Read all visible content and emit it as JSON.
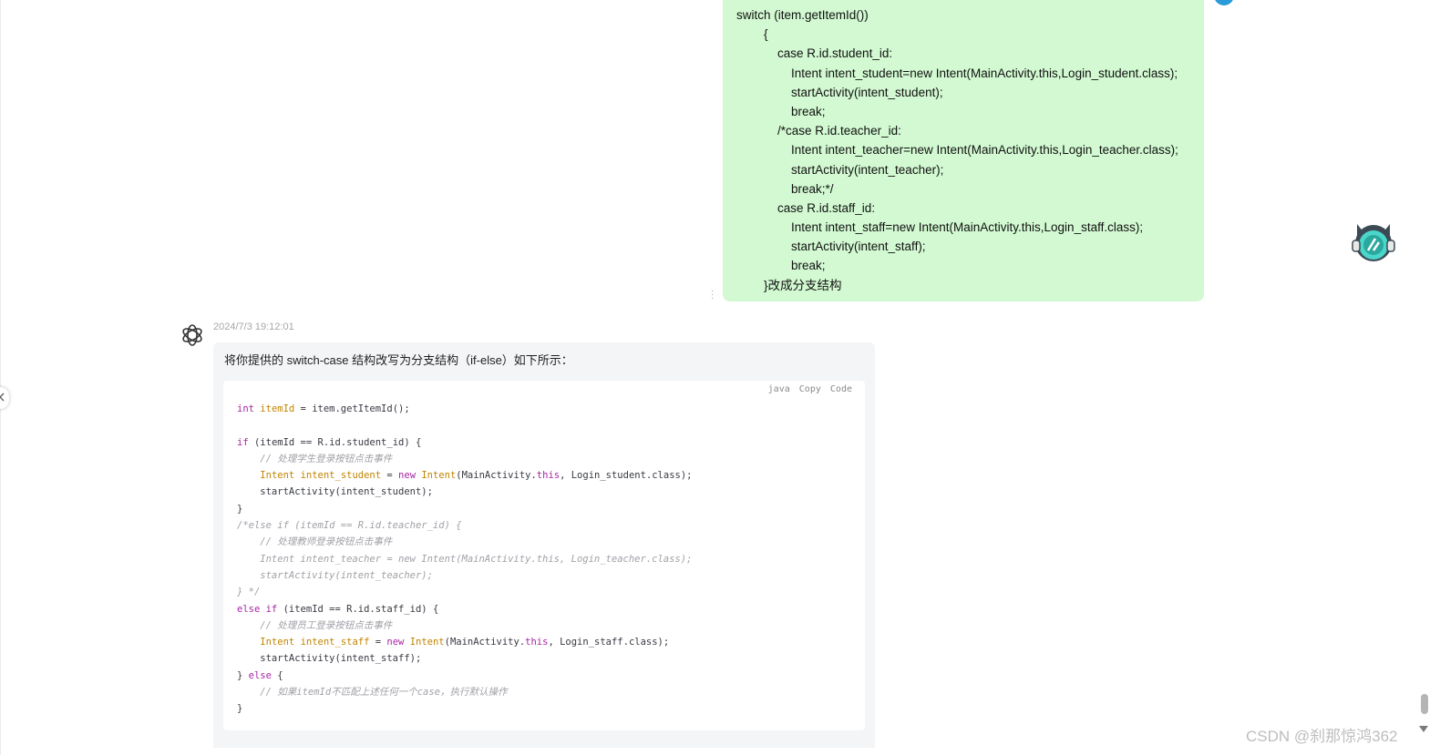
{
  "user_message": {
    "lines": [
      "switch (item.getItemId())",
      "        {",
      "            case R.id.student_id:",
      "                Intent intent_student=new Intent(MainActivity.this,Login_student.class);",
      "                startActivity(intent_student);",
      "                break;",
      "            /*case R.id.teacher_id:",
      "                Intent intent_teacher=new Intent(MainActivity.this,Login_teacher.class);",
      "                startActivity(intent_teacher);",
      "                break;*/",
      "            case R.id.staff_id:",
      "                Intent intent_staff=new Intent(MainActivity.this,Login_staff.class);",
      "                startActivity(intent_staff);",
      "                break;",
      "        }改成分支结构"
    ]
  },
  "assistant_message": {
    "timestamp": "2024/7/3 19:12:01",
    "intro": "将你提供的 switch-case 结构改写为分支结构（if-else）如下所示：",
    "code_block": {
      "language": "java",
      "copy_label": "Copy",
      "code_label": "Code"
    }
  },
  "watermark": "CSDN @刹那惊鸿362",
  "icons": [
    "chatgpt-logo-icon",
    "mascot-avatar-icon",
    "collapse-arrow-icon",
    "more-dots-icon"
  ],
  "colors": {
    "user_bubble": "#d2f9d1",
    "keyword": "#a626a4",
    "type": "#c18401",
    "comment": "#a0a1a7"
  }
}
